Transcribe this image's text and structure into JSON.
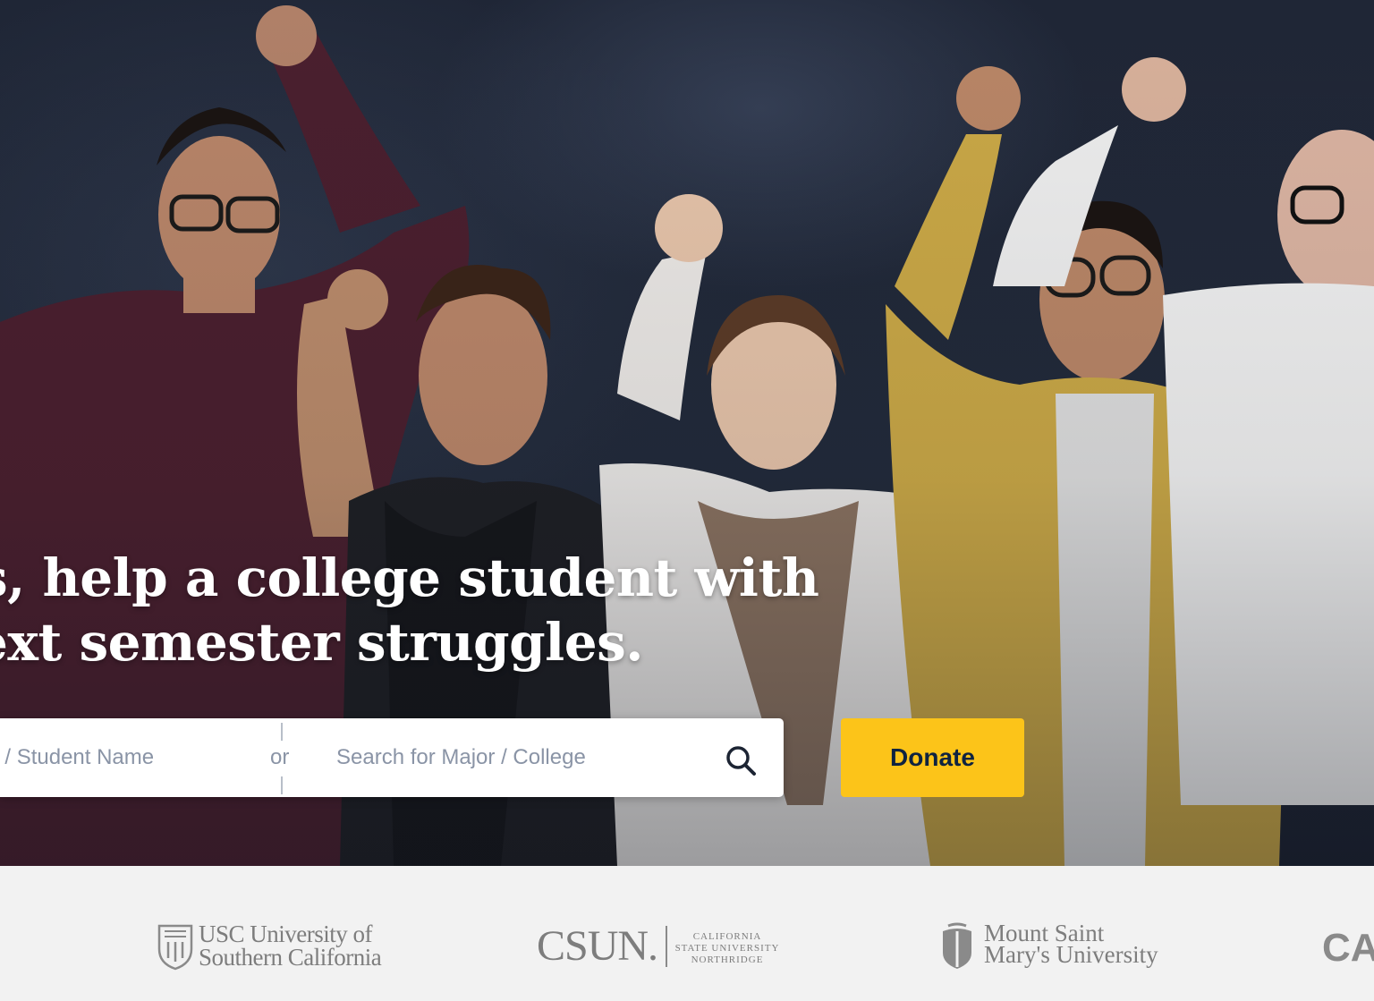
{
  "hero": {
    "headline_line1": "s, help a college student with",
    "headline_line2": "ext semester struggles."
  },
  "search": {
    "name_placeholder": "urces / Student Name",
    "or_label": "or",
    "major_placeholder": "Search for Major / College",
    "search_icon": "search-icon"
  },
  "donate": {
    "label": "Donate"
  },
  "colors": {
    "accent": "#fcc419",
    "accent_text": "#0f2340",
    "logo_gray": "#7d7d7d",
    "strip_bg": "#f2f2f2"
  },
  "partners": {
    "usc": {
      "line1": "USC University of",
      "line2": "Southern California"
    },
    "csun": {
      "mark": "CSUN.",
      "sub1": "CALIFORNIA",
      "sub2": "STATE UNIVERSITY",
      "sub3": "NORTHRIDGE"
    },
    "msmu": {
      "line1": "Mount  Saint",
      "line2": "Mary's  University"
    },
    "partial": "CA"
  }
}
